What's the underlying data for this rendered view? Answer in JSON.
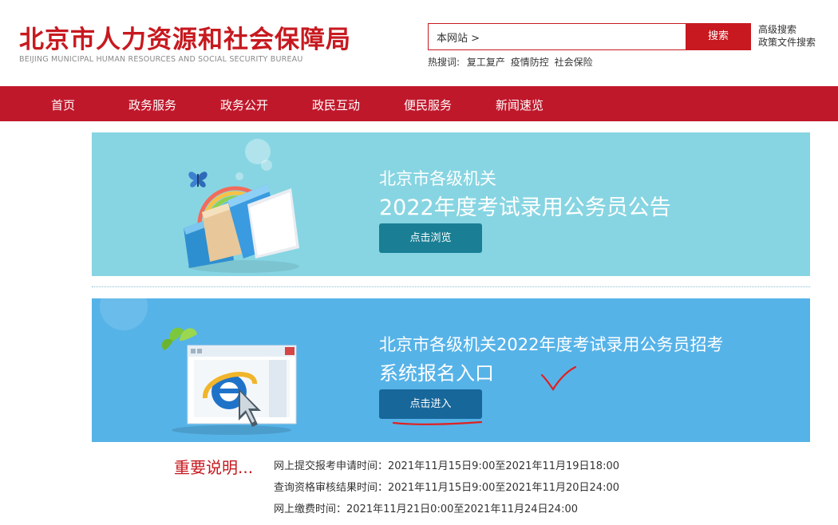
{
  "header": {
    "logo_cn": "北京市人力资源和社会保障局",
    "logo_en": "BEIJING MUNICIPAL HUMAN RESOURCES AND SOCIAL SECURITY BUREAU",
    "search_scope": "本网站 >",
    "search_button": "搜索",
    "advanced_search": "高级搜索",
    "policy_search": "政策文件搜索",
    "hot_label": "热搜词:",
    "hot_words": [
      "复工复产",
      "疫情防控",
      "社会保险"
    ]
  },
  "nav": {
    "items": [
      "首页",
      "政务服务",
      "政务公开",
      "政民互动",
      "便民服务",
      "新闻速览"
    ]
  },
  "banner1": {
    "line1": "北京市各级机关",
    "line2": "2022年度考试录用公务员公告",
    "button": "点击浏览"
  },
  "banner2": {
    "line1": "北京市各级机关2022年度考试录用公务员招考",
    "line2": "系统报名入口",
    "button": "点击进入"
  },
  "notes": {
    "title": "重要说明...",
    "lines": [
      "网上提交报考申请时间：2021年11月15日9:00至2021年11月19日18:00",
      "查询资格审核结果时间：2021年11月15日9:00至2021年11月20日24:00",
      "网上缴费时间：2021年11月21日0:00至2021年11月24日24:00"
    ]
  },
  "colors": {
    "brand_red": "#c7191f",
    "nav_red": "#c0182b",
    "banner1_bg": "#87d5e2",
    "banner2_bg": "#56b3e8"
  },
  "icons": [
    "folders-butterfly-illustration",
    "browser-window-illustration",
    "check-mark-annotation"
  ]
}
